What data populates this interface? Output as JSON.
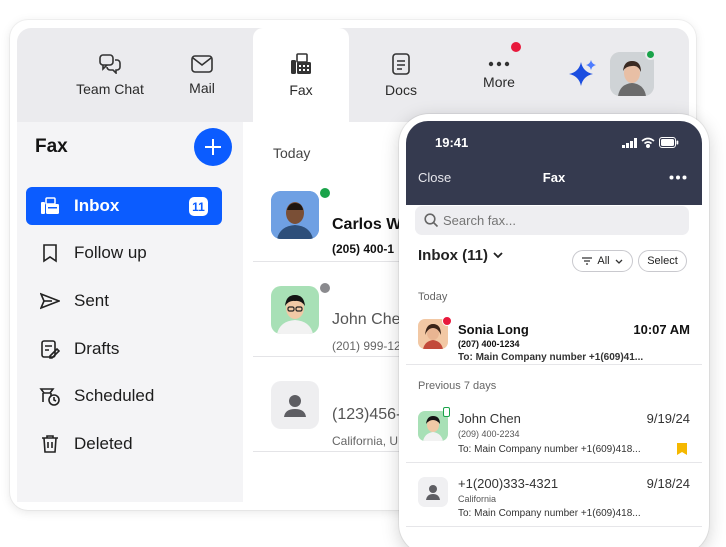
{
  "tabs": [
    {
      "label": "Team Chat",
      "icon": "team-chat-icon"
    },
    {
      "label": "Mail",
      "icon": "mail-icon"
    },
    {
      "label": "Fax",
      "icon": "fax-icon",
      "active": true
    },
    {
      "label": "Docs",
      "icon": "docs-icon"
    },
    {
      "label": "More",
      "icon": "more-icon"
    }
  ],
  "sidebar": {
    "title": "Fax",
    "items": [
      {
        "label": "Inbox",
        "icon": "inbox-icon",
        "badge": "11",
        "active": true
      },
      {
        "label": "Follow up",
        "icon": "bookmark-icon"
      },
      {
        "label": "Sent",
        "icon": "sent-icon"
      },
      {
        "label": "Drafts",
        "icon": "drafts-icon"
      },
      {
        "label": "Scheduled",
        "icon": "scheduled-icon"
      },
      {
        "label": "Deleted",
        "icon": "trash-icon"
      }
    ]
  },
  "list": {
    "section": "Today",
    "rows": [
      {
        "name": "Carlos Wa",
        "phone": "(205) 400-1"
      },
      {
        "name": "John Che",
        "phone": "(201) 999-12"
      },
      {
        "name": "(123)456-",
        "phone": "California, U"
      }
    ]
  },
  "phone": {
    "time": "19:41",
    "close": "Close",
    "title": "Fax",
    "search_placeholder": "Search fax...",
    "inbox_label": "Inbox (11)",
    "filter_label": "All",
    "select_label": "Select",
    "sections": {
      "today": "Today",
      "previous": "Previous 7 days"
    },
    "items": [
      {
        "name": "Sonia Long",
        "phone": "(207) 400-1234",
        "to": "To: Main Company number +1(609)41...",
        "time": "10:07 AM",
        "unread": true
      },
      {
        "name": "John Chen",
        "phone": "(209) 400-2234",
        "to": "To: Main Company number +1(609)418...",
        "time": "9/19/24"
      },
      {
        "name": "+1(200)333-4321",
        "phone": "California",
        "to": "To: Main Company number +1(609)418...",
        "time": "9/18/24"
      }
    ]
  },
  "colors": {
    "accent": "#0b5cff",
    "status_online": "#1aa34a",
    "alert": "#e8193c",
    "phone_header": "#353a4f",
    "bookmark": "#f5b800"
  }
}
